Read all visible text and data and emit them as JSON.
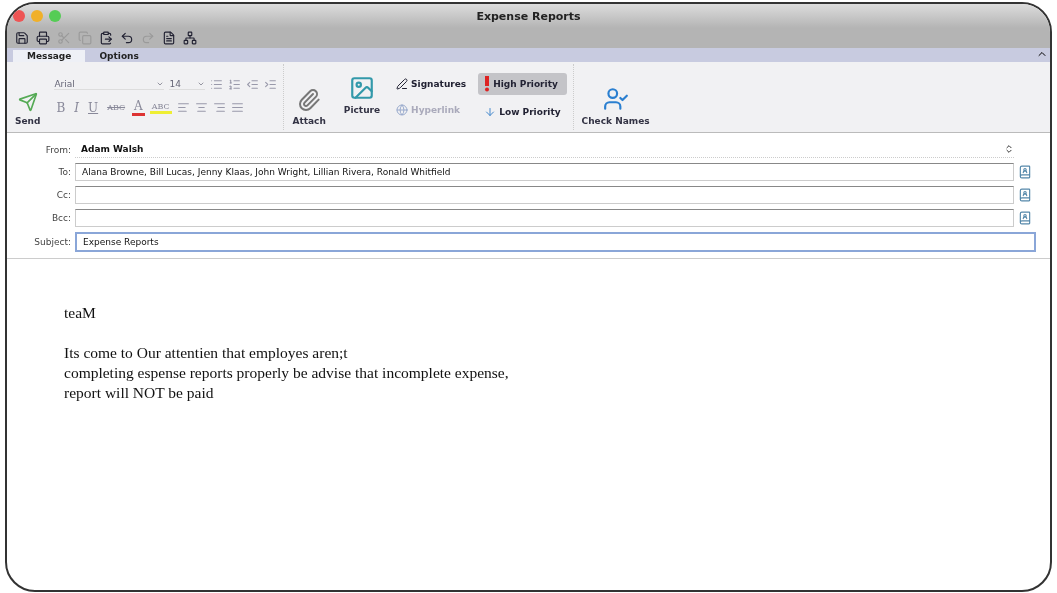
{
  "window": {
    "title": "Expense Reports"
  },
  "toolbar": [
    {
      "kind": "save",
      "disabled": false
    },
    {
      "kind": "print",
      "disabled": false
    },
    {
      "kind": "cut",
      "disabled": true
    },
    {
      "kind": "copy",
      "disabled": true
    },
    {
      "kind": "paste",
      "disabled": false
    },
    {
      "kind": "undo",
      "disabled": false
    },
    {
      "kind": "redo",
      "disabled": true
    },
    {
      "kind": "document",
      "disabled": false
    },
    {
      "kind": "network",
      "disabled": false
    }
  ],
  "tabs": [
    {
      "label": "Message",
      "selected": true
    },
    {
      "label": "Options",
      "selected": false
    }
  ],
  "ribbon": {
    "send": "Send",
    "font": "Arial",
    "size": "14",
    "format_buttons": [
      {
        "label": "B",
        "kind": "bold"
      },
      {
        "label": "I",
        "kind": "italic"
      },
      {
        "label": "U",
        "kind": "underline"
      },
      {
        "label": "ABC",
        "kind": "strike"
      },
      {
        "label": "A",
        "kind": "color"
      },
      {
        "label": "ABC",
        "kind": "highlight"
      }
    ],
    "attach": "Attach",
    "picture": "Picture",
    "signatures": "Signatures",
    "hyperlink": {
      "label": "Hyperlink",
      "disabled": true
    },
    "priority": [
      {
        "label": "High Priority",
        "kind": "high",
        "selected": true
      },
      {
        "label": "Low Priority",
        "kind": "low",
        "selected": false
      }
    ],
    "check_names": "Check Names"
  },
  "header": {
    "from": {
      "label": "From:",
      "value": "Adam Walsh"
    },
    "fields": [
      {
        "label": "To:",
        "value": "Alana Browne, Bill Lucas, Jenny Klaas, John Wright, Lillian Rivera, Ronald Whitfield"
      },
      {
        "label": "Cc:"
      },
      {
        "label": "Bcc:"
      }
    ],
    "subject": {
      "label": "Subject:",
      "value": "Expense Reports",
      "focused": true
    }
  },
  "body": [
    [
      "teaM"
    ],
    [
      "Its come to Our attentien that employes aren;t",
      "completing espense reports properly be advise that incomplete expense,",
      "report will NOT be paid"
    ]
  ]
}
